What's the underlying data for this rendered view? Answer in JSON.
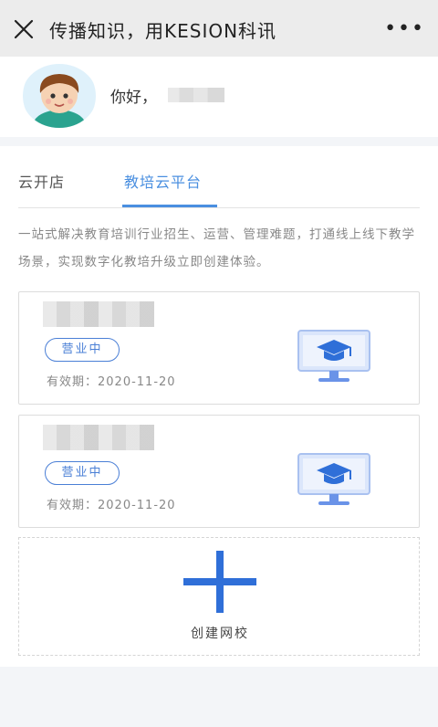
{
  "topbar": {
    "title": "传播知识，用KESION科讯",
    "more": "•••"
  },
  "profile": {
    "greeting": "你好，"
  },
  "tabs": [
    {
      "label": "云开店",
      "active": false
    },
    {
      "label": "教培云平台",
      "active": true
    }
  ],
  "description": "一站式解决教育培训行业招生、运营、管理难题，打通线上线下教学场景，实现数字化教培升级立即创建体验。",
  "shops": [
    {
      "status": "营业中",
      "expiry": "有效期：2020-11-20"
    },
    {
      "status": "营业中",
      "expiry": "有效期：2020-11-20"
    }
  ],
  "create": {
    "label": "创建网校"
  },
  "colors": {
    "accent": "#4a8fe0",
    "badge": "#4a7fd6",
    "plus": "#2f6fd8"
  }
}
